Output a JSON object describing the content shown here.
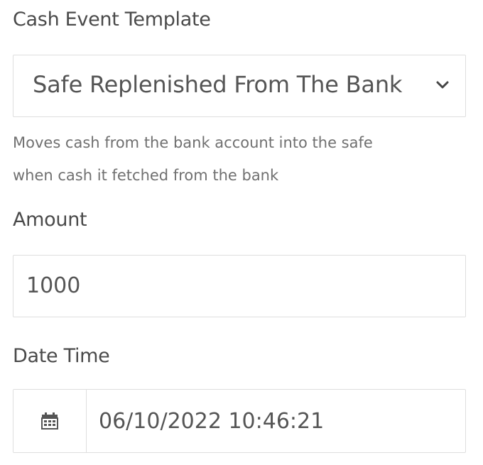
{
  "cash_event": {
    "label": "Cash Event Template",
    "selected": "Safe Replenished From The Bank",
    "help_line1": "Moves cash from the bank account into the safe",
    "help_line2": "when cash it fetched from the bank",
    "dropdown_icon": "chevron-down-icon"
  },
  "amount": {
    "label": "Amount",
    "value": "1000"
  },
  "date_time": {
    "label": "Date Time",
    "value": "06/10/2022 10:46:21",
    "icon": "calendar-icon"
  }
}
